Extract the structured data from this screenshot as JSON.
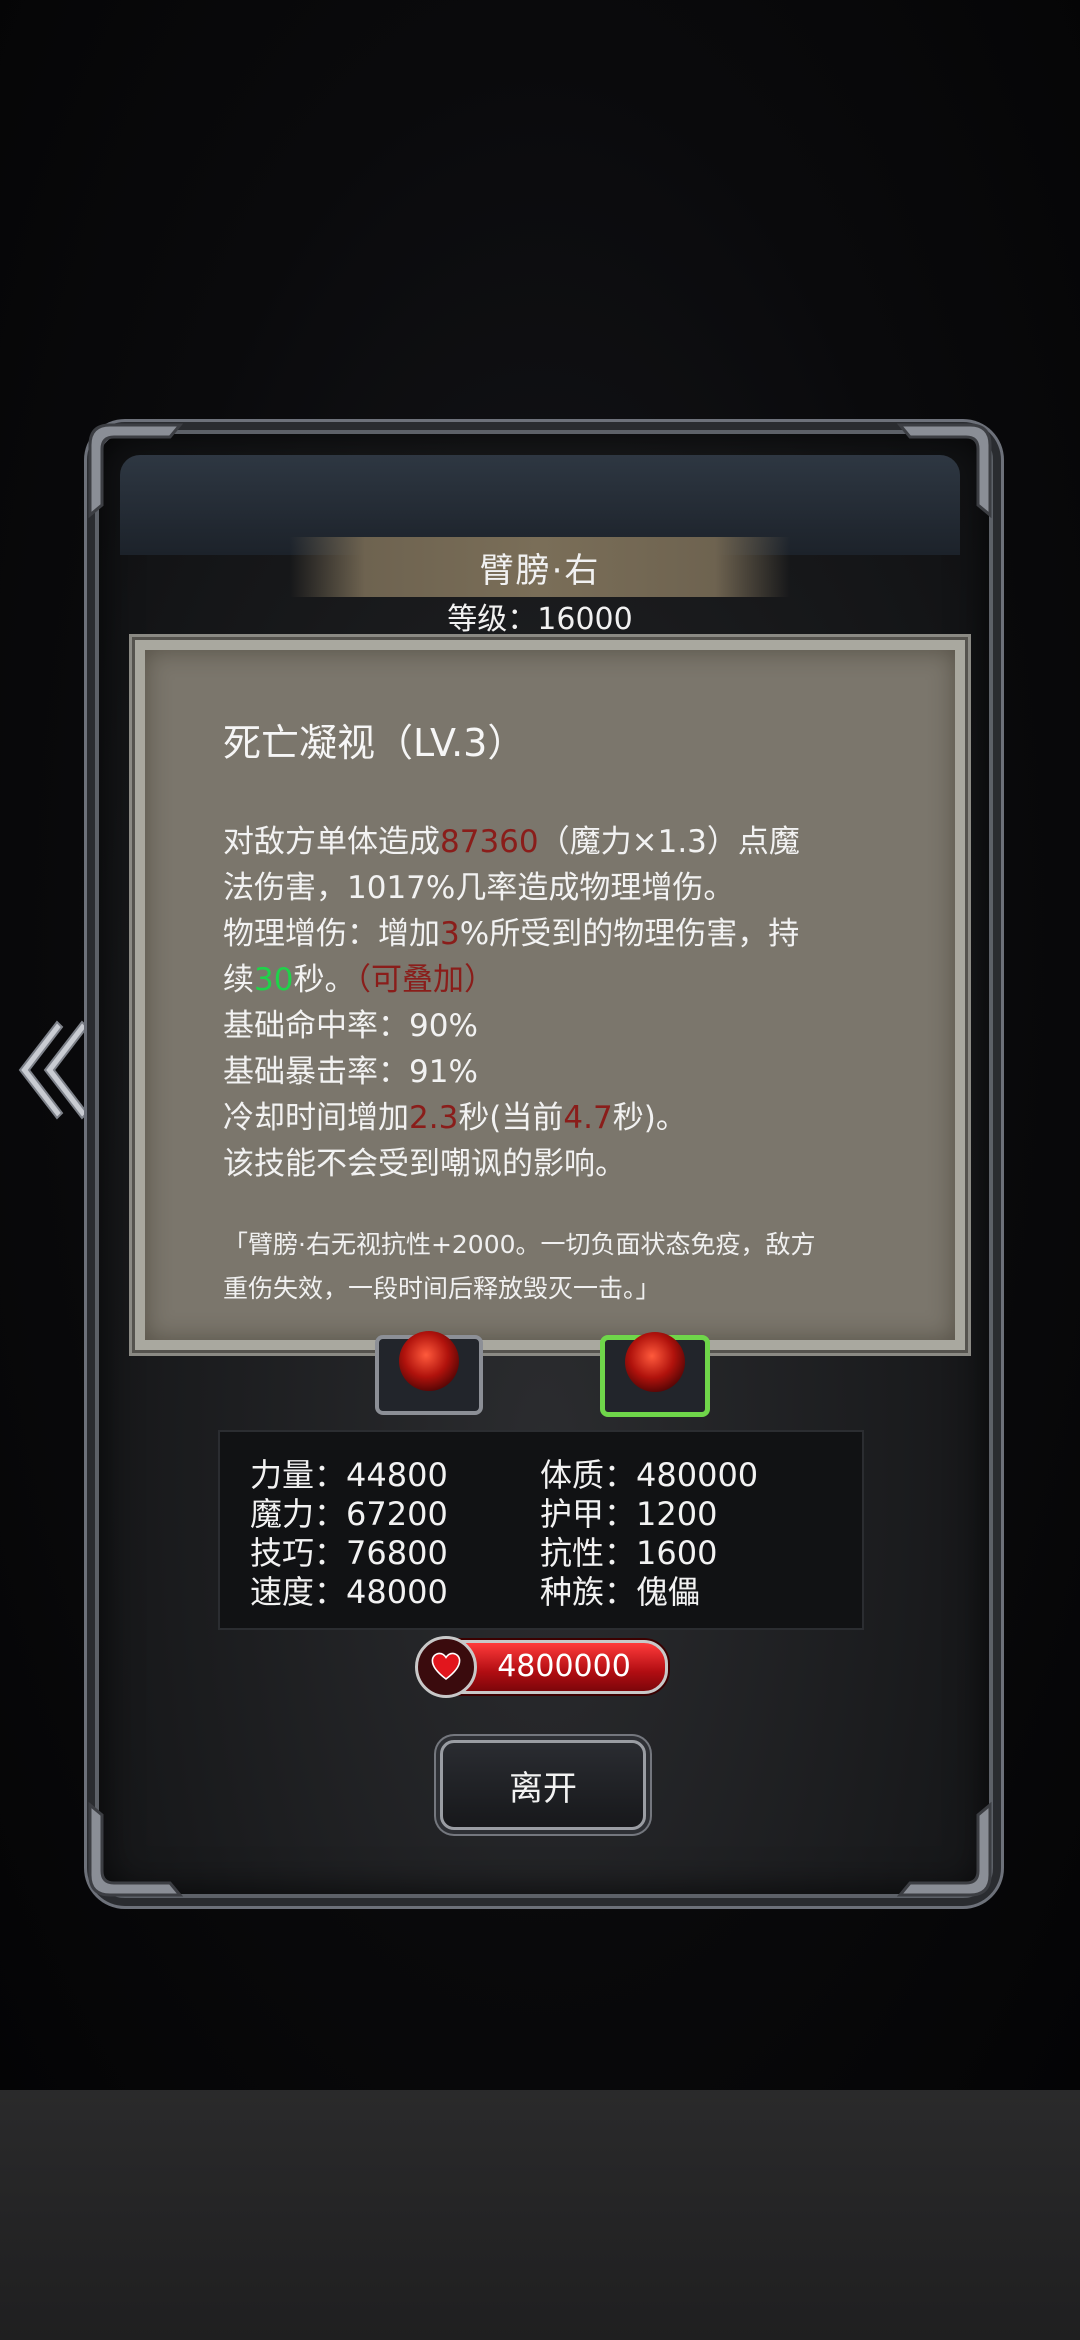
{
  "monster": {
    "name": "臂膀·右",
    "level_text": "等级：16000"
  },
  "skill": {
    "title": "死亡凝视（LV.3）",
    "lines": [
      {
        "parts": [
          {
            "t": "对敌方单体造成",
            "c": ""
          },
          {
            "t": "87360",
            "c": "red"
          },
          {
            "t": "（魔力×1.3）点魔",
            "c": ""
          }
        ]
      },
      {
        "parts": [
          {
            "t": "法伤害，1017%几率造成物理增伤。",
            "c": ""
          }
        ]
      },
      {
        "parts": [
          {
            "t": "物理增伤：增加",
            "c": ""
          },
          {
            "t": "3",
            "c": "red"
          },
          {
            "t": "%所受到的物理伤害，持",
            "c": ""
          }
        ]
      },
      {
        "parts": [
          {
            "t": "续",
            "c": ""
          },
          {
            "t": "30",
            "c": "green"
          },
          {
            "t": "秒。",
            "c": ""
          },
          {
            "t": "（可叠加）",
            "c": "red"
          }
        ]
      },
      {
        "parts": [
          {
            "t": "基础命中率：90%",
            "c": ""
          }
        ]
      },
      {
        "parts": [
          {
            "t": "基础暴击率：91%",
            "c": ""
          }
        ]
      },
      {
        "parts": [
          {
            "t": "冷却时间增加",
            "c": ""
          },
          {
            "t": "2.3",
            "c": "red"
          },
          {
            "t": "秒(当前",
            "c": ""
          },
          {
            "t": "4.7",
            "c": "red"
          },
          {
            "t": "秒)。",
            "c": ""
          }
        ]
      },
      {
        "parts": [
          {
            "t": "该技能不会受到嘲讽的影响。",
            "c": ""
          }
        ]
      }
    ],
    "quote_line1": "「臂膀·右无视抗性+2000。一切负面状态免疫，敌方",
    "quote_line2": "重伤失效，一段时间后释放毁灭一击。」"
  },
  "stats": {
    "strength": "力量：44800",
    "magic": "魔力：67200",
    "skill": "技巧：76800",
    "speed": "速度：48000",
    "constitution": "体质：480000",
    "armor": "护甲：1200",
    "resistance": "抗性：1600",
    "race": "种族：傀儡"
  },
  "hp": "4800000",
  "leave_label": "离开",
  "colors": {
    "damage_red": "#8a1d1a",
    "duration_green": "#1fd24a",
    "panel": "#7b766c",
    "hp_red": "#d2151b",
    "selected_gem_border": "#6fd64a"
  }
}
